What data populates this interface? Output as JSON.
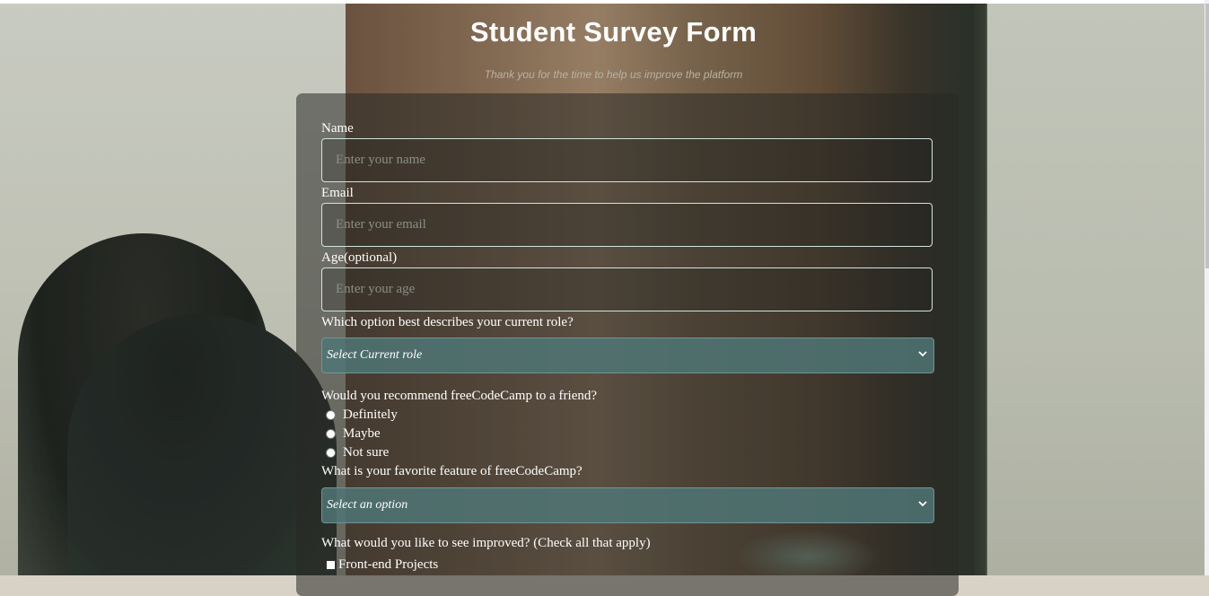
{
  "header": {
    "title": "Student Survey Form",
    "description": "Thank you for the time to help us improve the platform"
  },
  "form": {
    "name": {
      "label": "Name",
      "placeholder": "Enter your name",
      "value": ""
    },
    "email": {
      "label": "Email",
      "placeholder": "Enter your email",
      "value": ""
    },
    "age": {
      "label": "Age(optional)",
      "placeholder": "Enter your age",
      "value": ""
    },
    "role": {
      "label": "Which option best describes your current role?",
      "selected": "Select Current role"
    },
    "recommend": {
      "label": "Would you recommend freeCodeCamp to a friend?",
      "options": [
        "Definitely",
        "Maybe",
        "Not sure"
      ]
    },
    "feature": {
      "label": "What is your favorite feature of freeCodeCamp?",
      "selected": "Select an option"
    },
    "improve": {
      "label": "What would you like to see improved? (Check all that apply)",
      "options": [
        "Front-end Projects"
      ]
    }
  },
  "icons": {
    "select_chevron": "chevron-down-icon"
  },
  "colors": {
    "select_bg": "#4f7676",
    "card_bg": "#28281f",
    "text": "#ffffff"
  }
}
